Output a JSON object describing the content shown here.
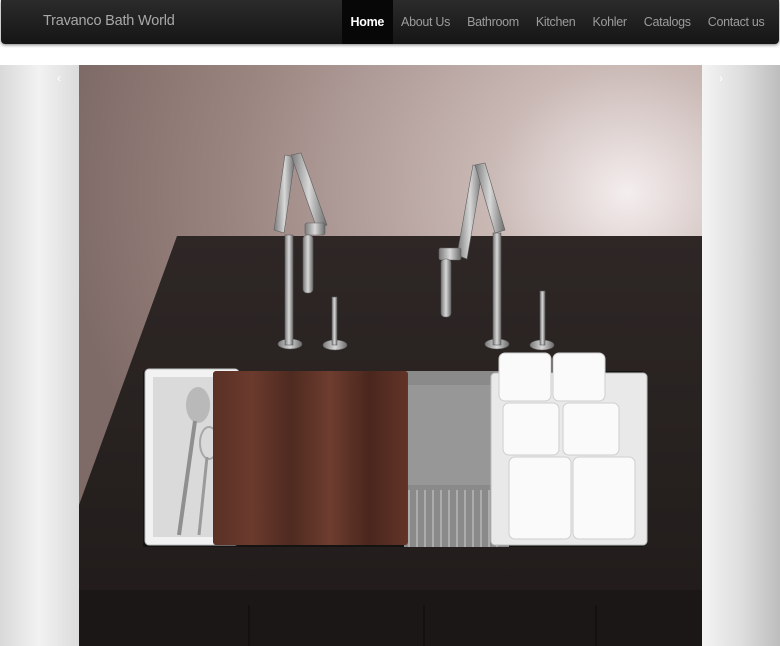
{
  "brand": {
    "name": "Travanco Bath World"
  },
  "nav": {
    "items": [
      {
        "label": "Home",
        "active": true
      },
      {
        "label": "About Us"
      },
      {
        "label": "Bathroom"
      },
      {
        "label": "Kitchen"
      },
      {
        "label": "Kohler"
      },
      {
        "label": "Catalogs"
      },
      {
        "label": "Contact us"
      }
    ]
  },
  "carousel": {
    "prev_glyph": "‹",
    "next_glyph": "›",
    "slide_icon": "kitchen-sink-photo-icon"
  },
  "colors": {
    "navbar": "#1e1e1e",
    "nav_text": "#9c9c9c",
    "nav_active_bg": "#070707",
    "counter": "#2a2322",
    "wall": "#a48f8a"
  }
}
